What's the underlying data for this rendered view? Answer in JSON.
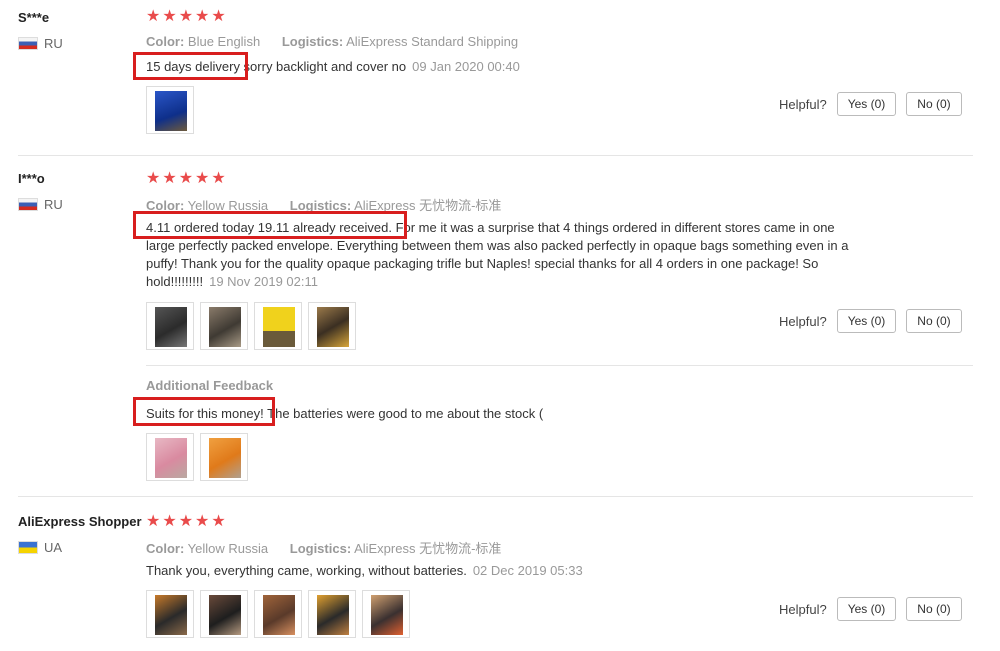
{
  "reviews": [
    {
      "user": "S***e",
      "country": "RU",
      "color_label": "Color:",
      "color_value": "Blue English",
      "logistics_label": "Logistics:",
      "logistics_value": "AliExpress Standard Shipping",
      "text": "15 days delivery sorry backlight and cover no",
      "date": "09 Jan 2020 00:40",
      "stars": 5,
      "thumbs": 1,
      "helpful_label": "Helpful?",
      "yes_label": "Yes (0)",
      "no_label": "No (0)"
    },
    {
      "user": "I***o",
      "country": "RU",
      "color_label": "Color:",
      "color_value": "Yellow Russia",
      "logistics_label": "Logistics:",
      "logistics_value": "AliExpress 无忧物流-标准",
      "text": "4.11 ordered today 19.11 already received. For me it was a surprise that 4 things ordered in different stores came in one large perfectly packed envelope. Everything between them was also packed perfectly in opaque bags something even in a puffy! Thank you for the quality opaque packaging trifle but Naples! special thanks for all 4 orders in one package! So hold!!!!!!!!!",
      "date": "19 Nov 2019 02:11",
      "stars": 5,
      "thumbs": 4,
      "helpful_label": "Helpful?",
      "yes_label": "Yes (0)",
      "no_label": "No (0)",
      "additional_label": "Additional Feedback",
      "additional_text": "Suits for this money! The batteries were good to me about the stock (",
      "additional_thumbs": 2
    },
    {
      "user": "AliExpress Shopper",
      "country": "UA",
      "color_label": "Color:",
      "color_value": "Yellow Russia",
      "logistics_label": "Logistics:",
      "logistics_value": "AliExpress 无忧物流-标准",
      "text": "Thank you, everything came, working, without batteries.",
      "date": "02 Dec 2019 05:33",
      "stars": 5,
      "thumbs": 5,
      "helpful_label": "Helpful?",
      "yes_label": "Yes (0)",
      "no_label": "No (0)"
    }
  ],
  "icons": {
    "star": "star-icon",
    "flag_ru": "russia-flag-icon",
    "flag_ua": "ukraine-flag-icon"
  },
  "colors": {
    "star": "#e94b4b",
    "highlight": "#d81e1e",
    "meta_text": "#999999"
  }
}
